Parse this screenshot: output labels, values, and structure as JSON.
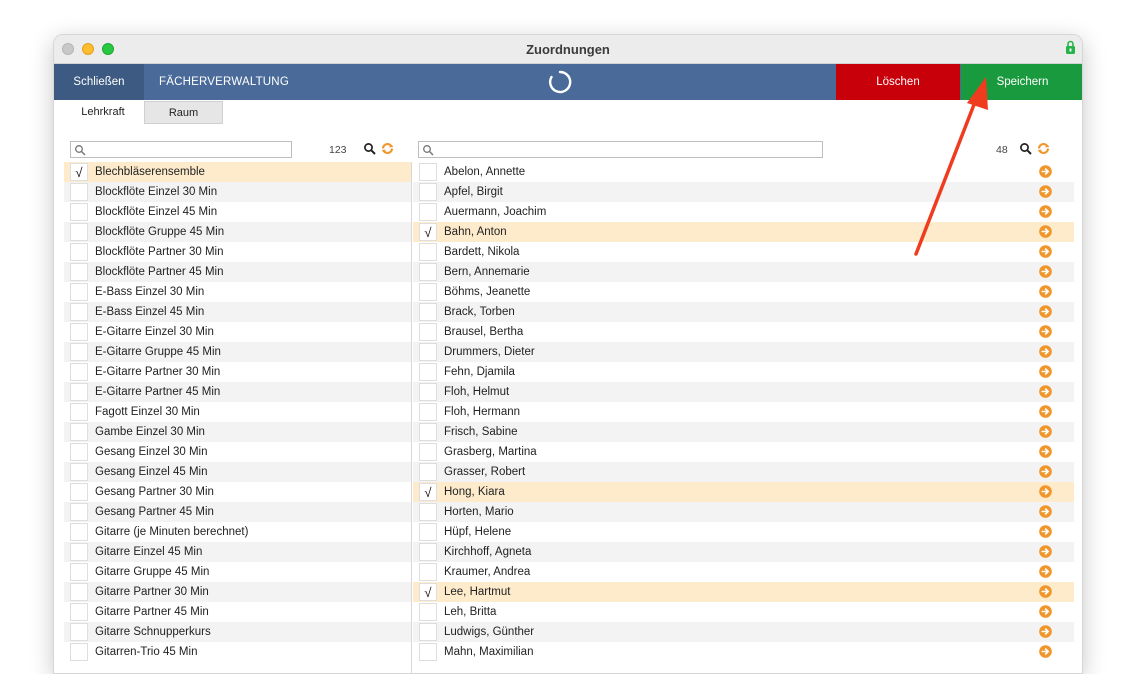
{
  "window": {
    "title": "Zuordnungen"
  },
  "toolbar": {
    "close_label": "Schließen",
    "faecher_label": "FÄCHERVERWALTUNG",
    "delete_label": "Löschen",
    "save_label": "Speichern"
  },
  "tabs": {
    "lehrkraft": "Lehrkraft",
    "raum": "Raum"
  },
  "colors": {
    "toolbar": "#4a6b9a",
    "delete": "#c8000a",
    "save": "#1a9a3e",
    "selected_row": "#fdebcc",
    "accent_icon": "#f0962a",
    "annotation_arrow": "#f03c1e"
  },
  "left_panel": {
    "search_value": "",
    "count": "123",
    "items": [
      {
        "label": "Blechbläserensemble",
        "checked": true
      },
      {
        "label": "Blockflöte Einzel 30 Min",
        "checked": false
      },
      {
        "label": "Blockflöte Einzel 45 Min",
        "checked": false
      },
      {
        "label": "Blockflöte Gruppe 45 Min",
        "checked": false
      },
      {
        "label": "Blockflöte Partner 30 Min",
        "checked": false
      },
      {
        "label": "Blockflöte Partner 45 Min",
        "checked": false
      },
      {
        "label": "E-Bass Einzel 30 Min",
        "checked": false
      },
      {
        "label": "E-Bass Einzel 45 Min",
        "checked": false
      },
      {
        "label": "E-Gitarre Einzel 30 Min",
        "checked": false
      },
      {
        "label": "E-Gitarre Gruppe 45 Min",
        "checked": false
      },
      {
        "label": "E-Gitarre Partner 30 Min",
        "checked": false
      },
      {
        "label": "E-Gitarre Partner 45 Min",
        "checked": false
      },
      {
        "label": "Fagott Einzel 30 Min",
        "checked": false
      },
      {
        "label": "Gambe Einzel 30 Min",
        "checked": false
      },
      {
        "label": "Gesang Einzel 30 Min",
        "checked": false
      },
      {
        "label": "Gesang Einzel 45 Min",
        "checked": false
      },
      {
        "label": "Gesang Partner 30 Min",
        "checked": false
      },
      {
        "label": "Gesang Partner 45 Min",
        "checked": false
      },
      {
        "label": "Gitarre (je Minuten berechnet)",
        "checked": false
      },
      {
        "label": "Gitarre Einzel 45 Min",
        "checked": false
      },
      {
        "label": "Gitarre Gruppe 45 Min",
        "checked": false
      },
      {
        "label": "Gitarre Partner 30 Min",
        "checked": false
      },
      {
        "label": "Gitarre Partner 45 Min",
        "checked": false
      },
      {
        "label": "Gitarre Schnupperkurs",
        "checked": false
      },
      {
        "label": "Gitarren-Trio 45 Min",
        "checked": false
      }
    ]
  },
  "right_panel": {
    "search_value": "",
    "count": "48",
    "items": [
      {
        "label": "Abelon, Annette",
        "checked": false
      },
      {
        "label": "Apfel, Birgit",
        "checked": false
      },
      {
        "label": "Auermann, Joachim",
        "checked": false
      },
      {
        "label": "Bahn, Anton",
        "checked": true
      },
      {
        "label": "Bardett, Nikola",
        "checked": false
      },
      {
        "label": "Bern, Annemarie",
        "checked": false
      },
      {
        "label": "Böhms, Jeanette",
        "checked": false
      },
      {
        "label": "Brack, Torben",
        "checked": false
      },
      {
        "label": "Brausel, Bertha",
        "checked": false
      },
      {
        "label": "Drummers, Dieter",
        "checked": false
      },
      {
        "label": "Fehn, Djamila",
        "checked": false
      },
      {
        "label": "Floh, Helmut",
        "checked": false
      },
      {
        "label": "Floh, Hermann",
        "checked": false
      },
      {
        "label": "Frisch, Sabine",
        "checked": false
      },
      {
        "label": "Grasberg, Martina",
        "checked": false
      },
      {
        "label": "Grasser, Robert",
        "checked": false
      },
      {
        "label": "Hong, Kiara",
        "checked": true
      },
      {
        "label": "Horten, Mario",
        "checked": false
      },
      {
        "label": "Hüpf, Helene",
        "checked": false
      },
      {
        "label": "Kirchhoff, Agneta",
        "checked": false
      },
      {
        "label": "Kraumer, Andrea",
        "checked": false
      },
      {
        "label": "Lee, Hartmut",
        "checked": true
      },
      {
        "label": "Leh, Britta",
        "checked": false
      },
      {
        "label": "Ludwigs, Günther",
        "checked": false
      },
      {
        "label": "Mahn, Maximilian",
        "checked": false
      }
    ]
  },
  "check_mark": "√"
}
